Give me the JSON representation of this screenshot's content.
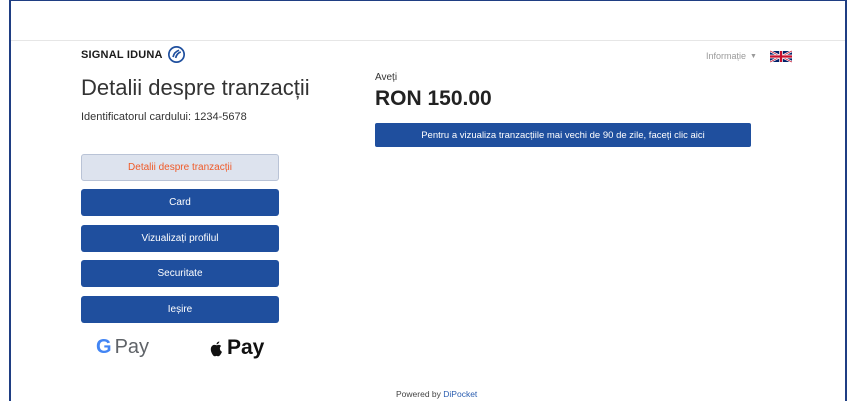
{
  "header": {
    "brand": "SIGNAL IDUNA",
    "info_menu": "Informație",
    "language_flag": "uk-flag-icon"
  },
  "page": {
    "title": "Detalii despre tranzacții",
    "card_id_label": "Identificatorul cardului:",
    "card_id_value": "1234-5678"
  },
  "sidebar": {
    "items": [
      {
        "label": "Detalii despre tranzacții",
        "active": true
      },
      {
        "label": "Card",
        "active": false
      },
      {
        "label": "Vizualizați profilul",
        "active": false
      },
      {
        "label": "Securitate",
        "active": false
      },
      {
        "label": "Ieșire",
        "active": false
      }
    ]
  },
  "payments": {
    "google_pay": "Pay",
    "apple_pay": "Pay"
  },
  "balance": {
    "label": "Aveți",
    "amount": "RON 150.00"
  },
  "older_tx_button": "Pentru a vizualiza tranzacțiile mai vechi de 90 de zile, faceți clic aici",
  "footer": {
    "powered_by": "Powered by",
    "provider": "DiPocket"
  },
  "colors": {
    "primary": "#1f4f9e",
    "active_bg": "#dde3ee",
    "active_text": "#f05a28",
    "link": "#2a5db0"
  }
}
